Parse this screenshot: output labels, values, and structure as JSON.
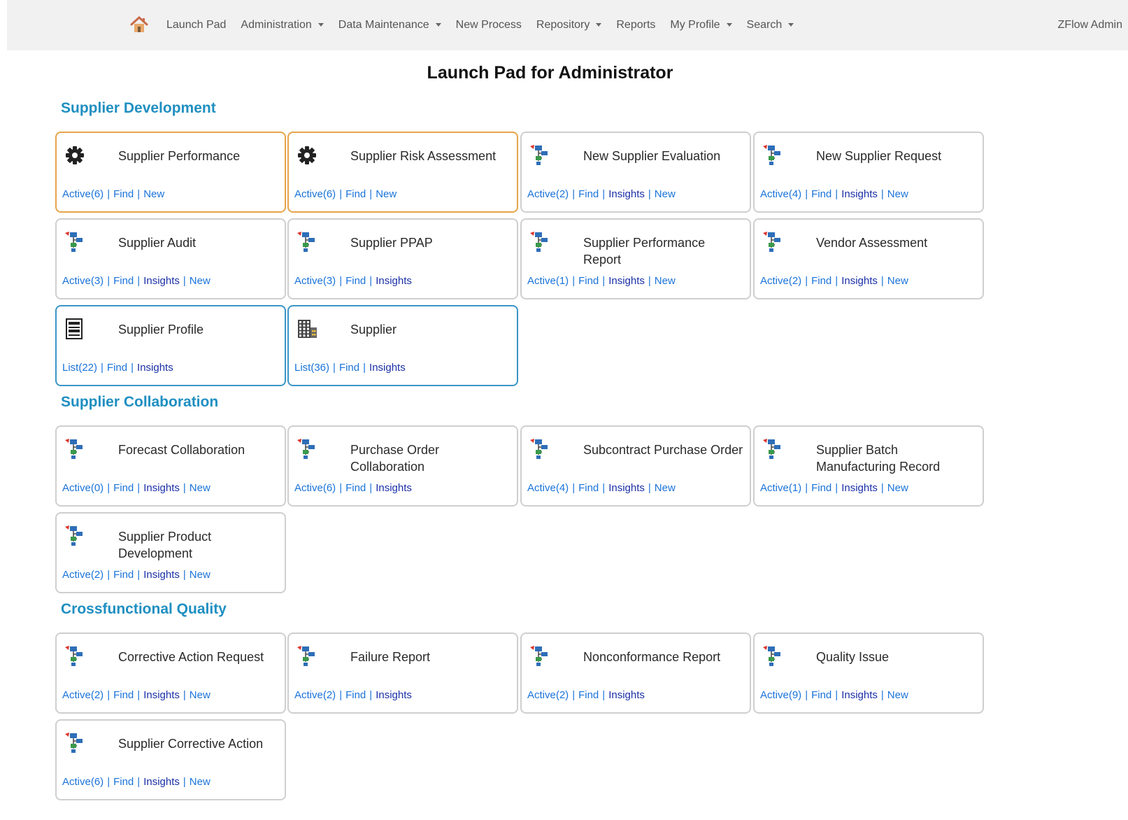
{
  "nav": {
    "items": [
      {
        "label": "Launch Pad",
        "dropdown": false
      },
      {
        "label": "Administration",
        "dropdown": true
      },
      {
        "label": "Data Maintenance",
        "dropdown": true
      },
      {
        "label": "New Process",
        "dropdown": false
      },
      {
        "label": "Repository",
        "dropdown": true
      },
      {
        "label": "Reports",
        "dropdown": false
      },
      {
        "label": "My Profile",
        "dropdown": true
      },
      {
        "label": "Search",
        "dropdown": true
      }
    ],
    "user": "ZFlow Admin",
    "home_icon": "home-icon"
  },
  "page_title": "Launch Pad for Administrator",
  "sections": [
    {
      "title": "Supplier Development",
      "cards": [
        {
          "title": "Supplier Performance",
          "icon": "gear-icon",
          "border": "orange",
          "links": [
            {
              "text": "Active(6)"
            },
            {
              "text": "Find"
            },
            {
              "text": "New"
            }
          ]
        },
        {
          "title": "Supplier Risk Assessment",
          "icon": "gear-icon",
          "border": "orange",
          "links": [
            {
              "text": "Active(6)"
            },
            {
              "text": "Find"
            },
            {
              "text": "New"
            }
          ]
        },
        {
          "title": "New Supplier Evaluation",
          "icon": "workflow-icon",
          "border": "gray",
          "links": [
            {
              "text": "Active(2)"
            },
            {
              "text": "Find"
            },
            {
              "text": "Insights"
            },
            {
              "text": "New"
            }
          ]
        },
        {
          "title": "New Supplier Request",
          "icon": "workflow-icon",
          "border": "gray",
          "links": [
            {
              "text": "Active(4)"
            },
            {
              "text": "Find"
            },
            {
              "text": "Insights"
            },
            {
              "text": "New"
            }
          ]
        },
        {
          "title": "Supplier Audit",
          "icon": "workflow-icon",
          "border": "gray",
          "links": [
            {
              "text": "Active(3)"
            },
            {
              "text": "Find"
            },
            {
              "text": "Insights"
            },
            {
              "text": "New"
            }
          ]
        },
        {
          "title": "Supplier PPAP",
          "icon": "workflow-icon",
          "border": "gray",
          "links": [
            {
              "text": "Active(3)"
            },
            {
              "text": "Find"
            },
            {
              "text": "Insights"
            }
          ]
        },
        {
          "title": "Supplier Performance Report",
          "icon": "workflow-icon",
          "border": "gray",
          "links": [
            {
              "text": "Active(1)"
            },
            {
              "text": "Find"
            },
            {
              "text": "Insights"
            },
            {
              "text": "New"
            }
          ]
        },
        {
          "title": "Vendor Assessment",
          "icon": "workflow-icon",
          "border": "gray",
          "links": [
            {
              "text": "Active(2)"
            },
            {
              "text": "Find"
            },
            {
              "text": "Insights"
            },
            {
              "text": "New"
            }
          ]
        },
        {
          "title": "Supplier Profile",
          "icon": "form-list-icon",
          "border": "blue",
          "links": [
            {
              "text": "List(22)"
            },
            {
              "text": "Find"
            },
            {
              "text": "Insights"
            }
          ]
        },
        {
          "title": "Supplier",
          "icon": "building-icon",
          "border": "blue",
          "links": [
            {
              "text": "List(36)"
            },
            {
              "text": "Find"
            },
            {
              "text": "Insights"
            }
          ]
        }
      ]
    },
    {
      "title": "Supplier Collaboration",
      "cards": [
        {
          "title": "Forecast Collaboration",
          "icon": "workflow-icon",
          "border": "gray",
          "links": [
            {
              "text": "Active(0)"
            },
            {
              "text": "Find"
            },
            {
              "text": "Insights"
            },
            {
              "text": "New"
            }
          ]
        },
        {
          "title": "Purchase Order Collaboration",
          "icon": "workflow-icon",
          "border": "gray",
          "links": [
            {
              "text": "Active(6)"
            },
            {
              "text": "Find"
            },
            {
              "text": "Insights"
            }
          ]
        },
        {
          "title": "Subcontract Purchase Order",
          "icon": "workflow-icon",
          "border": "gray",
          "links": [
            {
              "text": "Active(4)"
            },
            {
              "text": "Find"
            },
            {
              "text": "Insights"
            },
            {
              "text": "New"
            }
          ]
        },
        {
          "title": "Supplier Batch Manufacturing Record",
          "icon": "workflow-icon",
          "border": "gray",
          "links": [
            {
              "text": "Active(1)"
            },
            {
              "text": "Find"
            },
            {
              "text": "Insights"
            },
            {
              "text": "New"
            }
          ]
        },
        {
          "title": "Supplier Product Development",
          "icon": "workflow-icon",
          "border": "gray",
          "links": [
            {
              "text": "Active(2)"
            },
            {
              "text": "Find"
            },
            {
              "text": "Insights"
            },
            {
              "text": "New"
            }
          ]
        }
      ]
    },
    {
      "title": "Crossfunctional Quality",
      "cards": [
        {
          "title": "Corrective Action Request",
          "icon": "workflow-icon",
          "border": "gray",
          "links": [
            {
              "text": "Active(2)"
            },
            {
              "text": "Find"
            },
            {
              "text": "Insights"
            },
            {
              "text": "New"
            }
          ]
        },
        {
          "title": "Failure Report",
          "icon": "workflow-icon",
          "border": "gray",
          "links": [
            {
              "text": "Active(2)"
            },
            {
              "text": "Find"
            },
            {
              "text": "Insights"
            }
          ]
        },
        {
          "title": "Nonconformance Report",
          "icon": "workflow-icon",
          "border": "gray",
          "links": [
            {
              "text": "Active(2)"
            },
            {
              "text": "Find"
            },
            {
              "text": "Insights"
            }
          ]
        },
        {
          "title": "Quality Issue",
          "icon": "workflow-icon",
          "border": "gray",
          "links": [
            {
              "text": "Active(9)"
            },
            {
              "text": "Find"
            },
            {
              "text": "Insights"
            },
            {
              "text": "New"
            }
          ]
        },
        {
          "title": "Supplier Corrective Action",
          "icon": "workflow-icon",
          "border": "gray",
          "links": [
            {
              "text": "Active(6)"
            },
            {
              "text": "Find"
            },
            {
              "text": "Insights"
            },
            {
              "text": "New"
            }
          ]
        }
      ]
    }
  ]
}
